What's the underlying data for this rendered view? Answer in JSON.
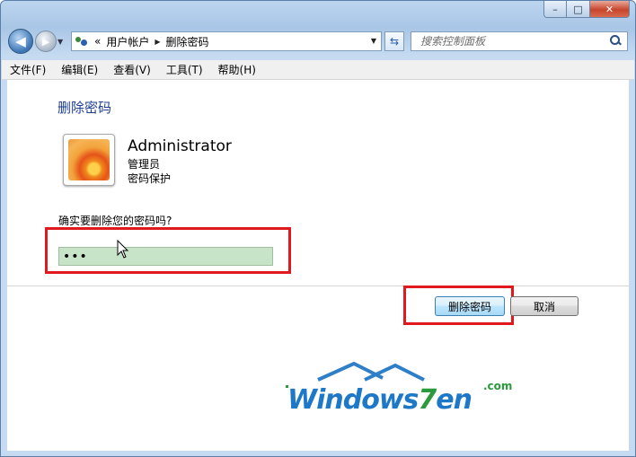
{
  "window": {
    "caption": {
      "minimize": "–",
      "maximize": "□",
      "close": "✕"
    }
  },
  "nav": {
    "back_icon": "arrow-left-icon",
    "forward_icon": "arrow-right-icon",
    "breadcrumb_prefix": "«",
    "breadcrumb": [
      "用户帐户",
      "删除密码"
    ],
    "search_placeholder": "搜索控制面板"
  },
  "menu": [
    "文件(F)",
    "编辑(E)",
    "查看(V)",
    "工具(T)",
    "帮助(H)"
  ],
  "main": {
    "title": "删除密码",
    "user": {
      "name": "Administrator",
      "role": "管理员",
      "status": "密码保护"
    },
    "question": "确实要删除您的密码吗?",
    "password_value": "•••",
    "buttons": {
      "confirm": "删除密码",
      "cancel": "取消"
    }
  },
  "watermark": {
    "text": "Windows7en",
    "suffix": ".com"
  },
  "colors": {
    "title_blue": "#1e3f8f",
    "highlight_red": "#e0191e",
    "field_green": "#c8e4c8"
  }
}
